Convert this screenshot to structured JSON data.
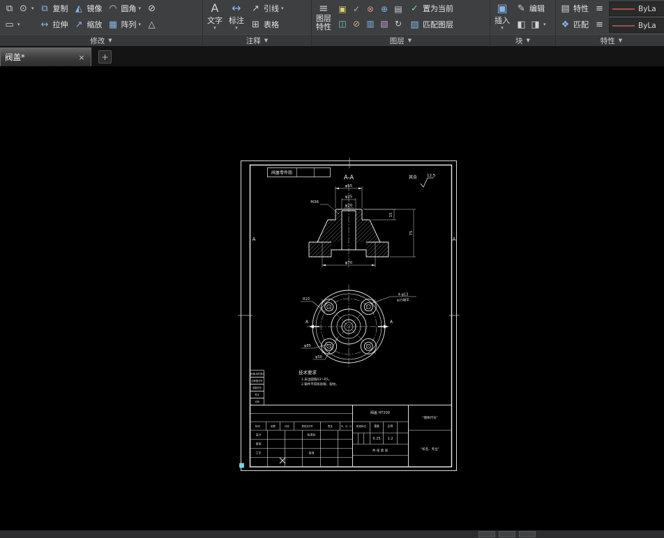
{
  "ui": {
    "caret_down": "▼",
    "caret_small": "▾"
  },
  "icons": {
    "move": "⧉",
    "rotate": "⊙",
    "trim": "▭",
    "copy": "⧉",
    "stretch": "↔",
    "mirror": "◭",
    "scale": "↗",
    "fillet": "◠",
    "array": "▦",
    "erase2": "⊘",
    "explode": "△",
    "text": "A",
    "dimension": "↔",
    "leader": "↗",
    "table": "⊞",
    "layer_props": "≡",
    "lt1": "▣",
    "lt2": "✓",
    "lt3": "⊗",
    "lt4": "⊕",
    "lt5": "▤",
    "lt6": "◫",
    "lt7": "⊘",
    "lt8": "▥",
    "lt9": "▧",
    "lt10": "↻",
    "set_current": "✓",
    "match_layer": "▨",
    "insert": "▣",
    "edit": "✎",
    "block_a": "◧",
    "block_b": "◨",
    "properties": "▤",
    "match_props": "❖",
    "list": "≡"
  },
  "ribbon": {
    "modify": {
      "label": "修改",
      "copy": "复制",
      "stretch": "拉伸",
      "mirror": "镜像",
      "scale": "缩放",
      "fillet": "圆角",
      "array": "阵列"
    },
    "annotate": {
      "label": "注释",
      "text": "文字",
      "dimension": "标注",
      "leader": "引线",
      "table": "表格"
    },
    "layers": {
      "label": "图层",
      "props1": "图层",
      "props2": "特性",
      "set_current": "置为当前",
      "match_layer": "匹配图层"
    },
    "block": {
      "label": "块",
      "insert": "插入",
      "edit": "编辑"
    },
    "properties": {
      "label": "特性",
      "props": "特性",
      "match": "匹配",
      "bylayer1": "ByLa",
      "bylayer2": "ByLa"
    }
  },
  "tabs": {
    "drawing": "阀盖*",
    "close": "×",
    "new": "+"
  },
  "sheet": {
    "top_note": "阀盖零件图",
    "section_label": "A-A",
    "surface_prefix": "其余",
    "roughness": "12.5",
    "zone_left": "A",
    "zone_right": "A",
    "dims": {
      "d55": "φ55",
      "d25": "φ25",
      "d20": "φ20",
      "d70": "φ70",
      "h15": "15",
      "h75": "75",
      "thread": "M36",
      "holes1": "4-φ13",
      "holes2": "φ25锪平",
      "r10": "R10",
      "d85": "φ85",
      "d50": "φ50",
      "sec_a_left": "A",
      "sec_a_right": "A"
    },
    "tech": {
      "title": "技术要求",
      "line1": "1.未注圆角R3～R5。",
      "line2": "2.铸件不得有砂眼、裂纹。"
    },
    "side_blocks": [
      "借(通)用件登记",
      "旧底图总号",
      "底图总号",
      "签字",
      "日期"
    ],
    "title_block": {
      "part_note": "阀盖 HT200",
      "h1": "标记",
      "h2": "处数",
      "h3": "分区",
      "h4": "更改文件号",
      "h5": "签名",
      "h6": "年、月、日",
      "r1": "设计",
      "r2": "审核",
      "r3": "工艺",
      "r4": "标准化",
      "r5": "批准",
      "stage": "阶段标记",
      "weight_label": "重量",
      "scale_label": "比例",
      "weight": "0.25",
      "scale": "1:2",
      "sheets": "共 张 第 张",
      "code": "“图样代号”",
      "school": "“校名、专业”"
    }
  }
}
